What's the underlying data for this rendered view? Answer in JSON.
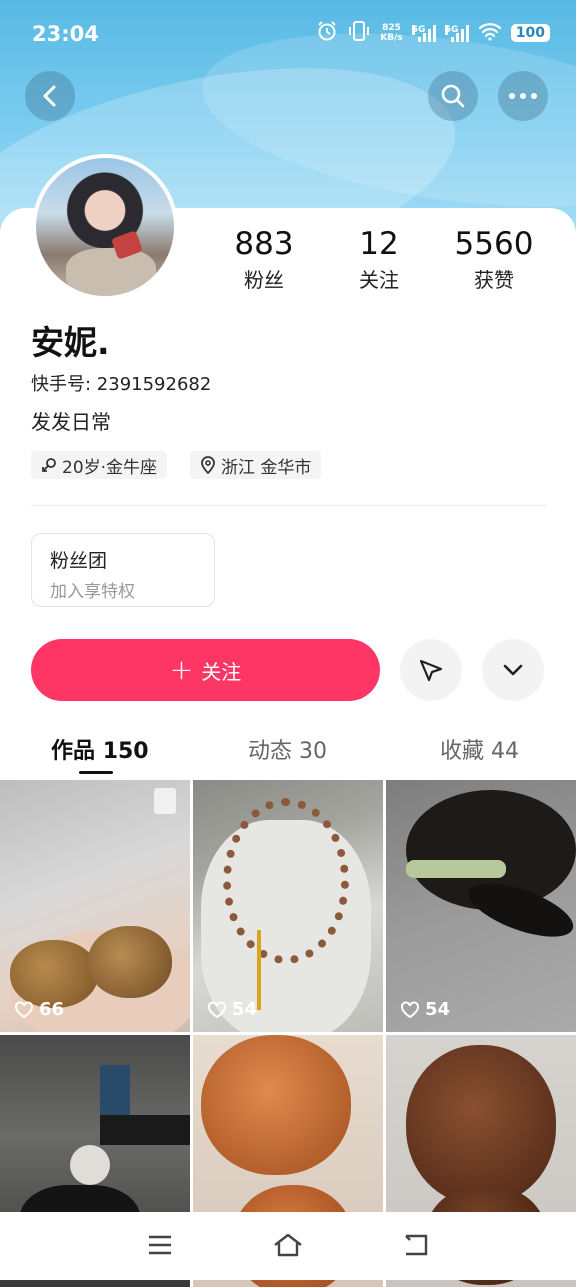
{
  "status_bar": {
    "time": "23:04",
    "net_speed_value": "825",
    "net_speed_unit": "KB/s",
    "sim1_label": "5G",
    "sim2_label": "5G",
    "battery": "100",
    "icons": [
      "alarm-icon",
      "vibrate-icon",
      "signal-icon",
      "wifi-icon",
      "battery-icon"
    ]
  },
  "header": {
    "back_icon": "chevron-left-icon",
    "search_icon": "search-icon",
    "more_icon": "more-icon"
  },
  "profile": {
    "stats": [
      {
        "value": "883",
        "label": "粉丝"
      },
      {
        "value": "12",
        "label": "关注"
      },
      {
        "value": "5560",
        "label": "获赞"
      }
    ],
    "name": "安妮.",
    "user_id": "快手号: 2391592682",
    "bio": "发发日常",
    "tags": [
      {
        "icon": "gender-female-icon",
        "text": "20岁·金牛座"
      },
      {
        "icon": "location-icon",
        "text": "浙江 金华市"
      }
    ]
  },
  "fans_club": {
    "title": "粉丝团",
    "subtitle": "加入享特权"
  },
  "actions": {
    "follow_label": "关注",
    "follow_color": "#fe3666",
    "share_icon": "send-icon",
    "more_icon": "chevron-down-icon"
  },
  "tabs": [
    {
      "label": "作品",
      "count": "150",
      "active": true
    },
    {
      "label": "动态",
      "count": "30",
      "active": false
    },
    {
      "label": "收藏",
      "count": "44",
      "active": false
    }
  ],
  "posts": [
    {
      "likes": "66",
      "badge": "image-album-icon"
    },
    {
      "likes": "54"
    },
    {
      "likes": "54"
    },
    {},
    {},
    {}
  ],
  "nav_bar": {
    "icons": [
      "menu-icon",
      "home-icon",
      "back-icon"
    ]
  }
}
